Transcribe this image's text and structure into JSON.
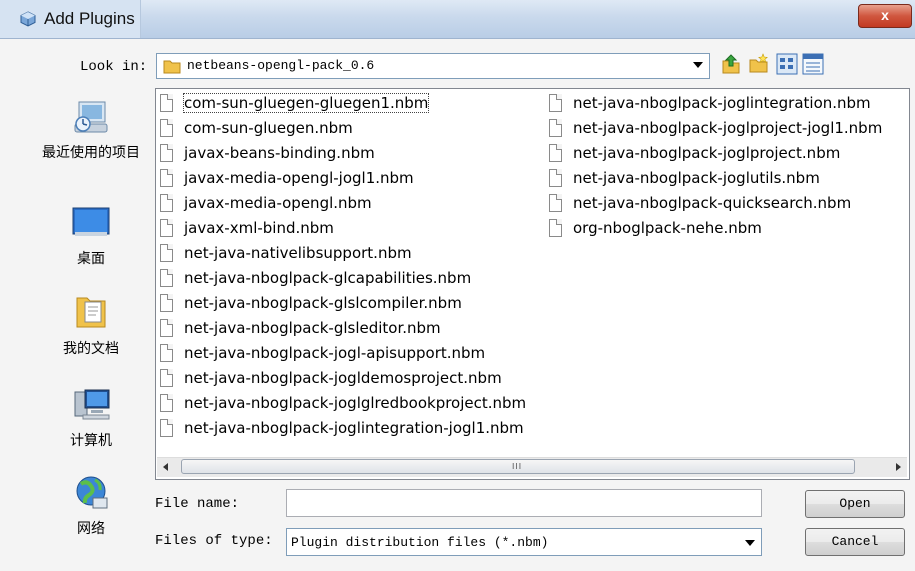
{
  "window": {
    "title": "Add Plugins",
    "close_label": "x"
  },
  "look_in": {
    "label": "Look in:",
    "value": "netbeans-opengl-pack_0.6"
  },
  "toolbar": {
    "icons": [
      "up-one-level-icon",
      "new-folder-icon",
      "list-view-icon",
      "details-view-icon"
    ]
  },
  "places": [
    {
      "label": "最近使用的项目",
      "icon": "recent-places-icon"
    },
    {
      "label": "桌面",
      "icon": "desktop-icon"
    },
    {
      "label": "我的文档",
      "icon": "documents-icon"
    },
    {
      "label": "计算机",
      "icon": "computer-icon"
    },
    {
      "label": "网络",
      "icon": "network-icon"
    }
  ],
  "files_col1": [
    "com-sun-gluegen-gluegen1.nbm",
    "com-sun-gluegen.nbm",
    "javax-beans-binding.nbm",
    "javax-media-opengl-jogl1.nbm",
    "javax-media-opengl.nbm",
    "javax-xml-bind.nbm",
    "net-java-nativelibsupport.nbm",
    "net-java-nboglpack-glcapabilities.nbm",
    "net-java-nboglpack-glslcompiler.nbm",
    "net-java-nboglpack-glsleditor.nbm",
    "net-java-nboglpack-jogl-apisupport.nbm",
    "net-java-nboglpack-jogldemosproject.nbm",
    "net-java-nboglpack-joglglredbookproject.nbm",
    "net-java-nboglpack-joglintegration-jogl1.nbm"
  ],
  "files_col2": [
    "net-java-nboglpack-joglintegration.nbm",
    "net-java-nboglpack-joglproject-jogl1.nbm",
    "net-java-nboglpack-joglproject.nbm",
    "net-java-nboglpack-joglutils.nbm",
    "net-java-nboglpack-quicksearch.nbm",
    "org-nboglpack-nehe.nbm"
  ],
  "scrollbar": {
    "grip": "III"
  },
  "file_name": {
    "label": "File name:",
    "value": ""
  },
  "file_type": {
    "label": "Files of type:",
    "value": "Plugin distribution files (*.nbm)"
  },
  "buttons": {
    "open": "Open",
    "cancel": "Cancel"
  }
}
